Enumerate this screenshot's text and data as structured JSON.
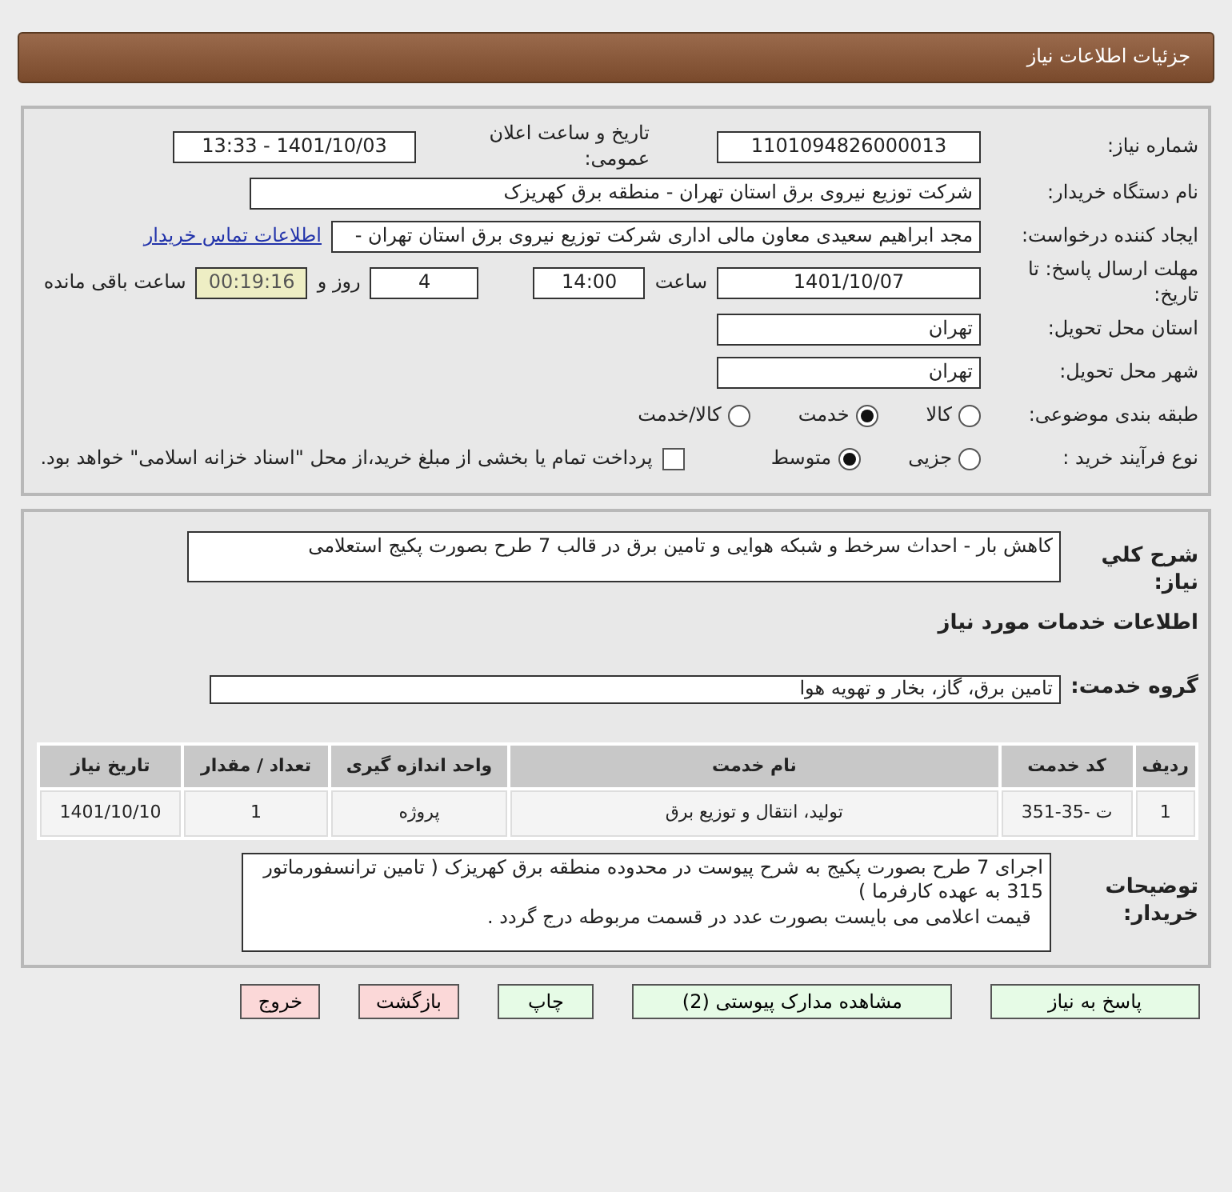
{
  "header": {
    "title": "جزئیات اطلاعات نیاز"
  },
  "info": {
    "need_number": {
      "label": "شماره نیاز:",
      "value": "1101094826000013"
    },
    "announce": {
      "label": "تاریخ و ساعت اعلان عمومی:",
      "value": "1401/10/03 - 13:33"
    },
    "buyer_org": {
      "label": "نام دستگاه خریدار:",
      "value": "شرکت توزیع نیروی برق استان تهران  - منطقه برق کهریزک"
    },
    "requester": {
      "label": "ایجاد کننده درخواست:",
      "value": "مجد ابراهیم  سعیدی معاون مالی اداری  شرکت توزیع نیروی برق استان تهران  -",
      "link": "اطلاعات تماس خریدار"
    },
    "deadline": {
      "label": "مهلت ارسال پاسخ: تا تاریخ:",
      "date": "1401/10/07",
      "time_label": "ساعت",
      "time": "14:00",
      "days": "4",
      "days_label": "روز و",
      "remaining": "00:19:16",
      "remaining_label": "ساعت باقی مانده"
    },
    "province": {
      "label": "استان محل تحویل:",
      "value": "تهران"
    },
    "city": {
      "label": "شهر محل تحویل:",
      "value": "تهران"
    },
    "category": {
      "label": "طبقه بندی موضوعی:",
      "options": [
        {
          "label": "کالا",
          "selected": false
        },
        {
          "label": "خدمت",
          "selected": true
        },
        {
          "label": "کالا/خدمت",
          "selected": false
        }
      ]
    },
    "process": {
      "label": "نوع فرآیند خرید :",
      "options": [
        {
          "label": "جزیی",
          "selected": false
        },
        {
          "label": "متوسط",
          "selected": true
        }
      ],
      "payment": {
        "label": "پرداخت تمام یا بخشی از مبلغ خرید،از محل \"اسناد خزانه اسلامی\" خواهد بود.",
        "checked": false
      }
    }
  },
  "details": {
    "description": {
      "label": "شرح كلي نياز:",
      "value": "کاهش بار - احداث سرخط و شبکه هوایی و تامین برق در قالب 7 طرح بصورت پکیج استعلامی"
    },
    "services_heading": "اطلاعات خدمات مورد نیاز",
    "service_group": {
      "label": "گروه خدمت:",
      "value": "تامین برق، گاز، بخار و تهویه هوا"
    },
    "table": {
      "columns": [
        "ردیف",
        "کد خدمت",
        "نام خدمت",
        "واحد اندازه گیری",
        "تعداد / مقدار",
        "تاریخ نیاز"
      ],
      "rows": [
        [
          "1",
          "ت -35-351",
          "تولید، انتقال و توزیع برق",
          "پروژه",
          "1",
          "1401/10/10"
        ]
      ]
    },
    "notes": {
      "label": "توضیحات خریدار:",
      "lines": [
        "اجرای 7 طرح بصورت پکیج به شرح پیوست در محدوده منطقه برق کهریزک ( تامین ترانسفورماتور 315 به عهده کارفرما )",
        "  قیمت اعلامی می بایست بصورت عدد در قسمت مربوطه درج گردد ."
      ]
    }
  },
  "buttons": [
    {
      "label": "پاسخ به نیاز",
      "kind": "primary"
    },
    {
      "label": "مشاهده مدارک پیوستی (2)",
      "kind": "primary"
    },
    {
      "label": "چاپ",
      "kind": "primary"
    },
    {
      "label": "بازگشت",
      "kind": "danger"
    },
    {
      "label": "خروج",
      "kind": "danger"
    }
  ]
}
